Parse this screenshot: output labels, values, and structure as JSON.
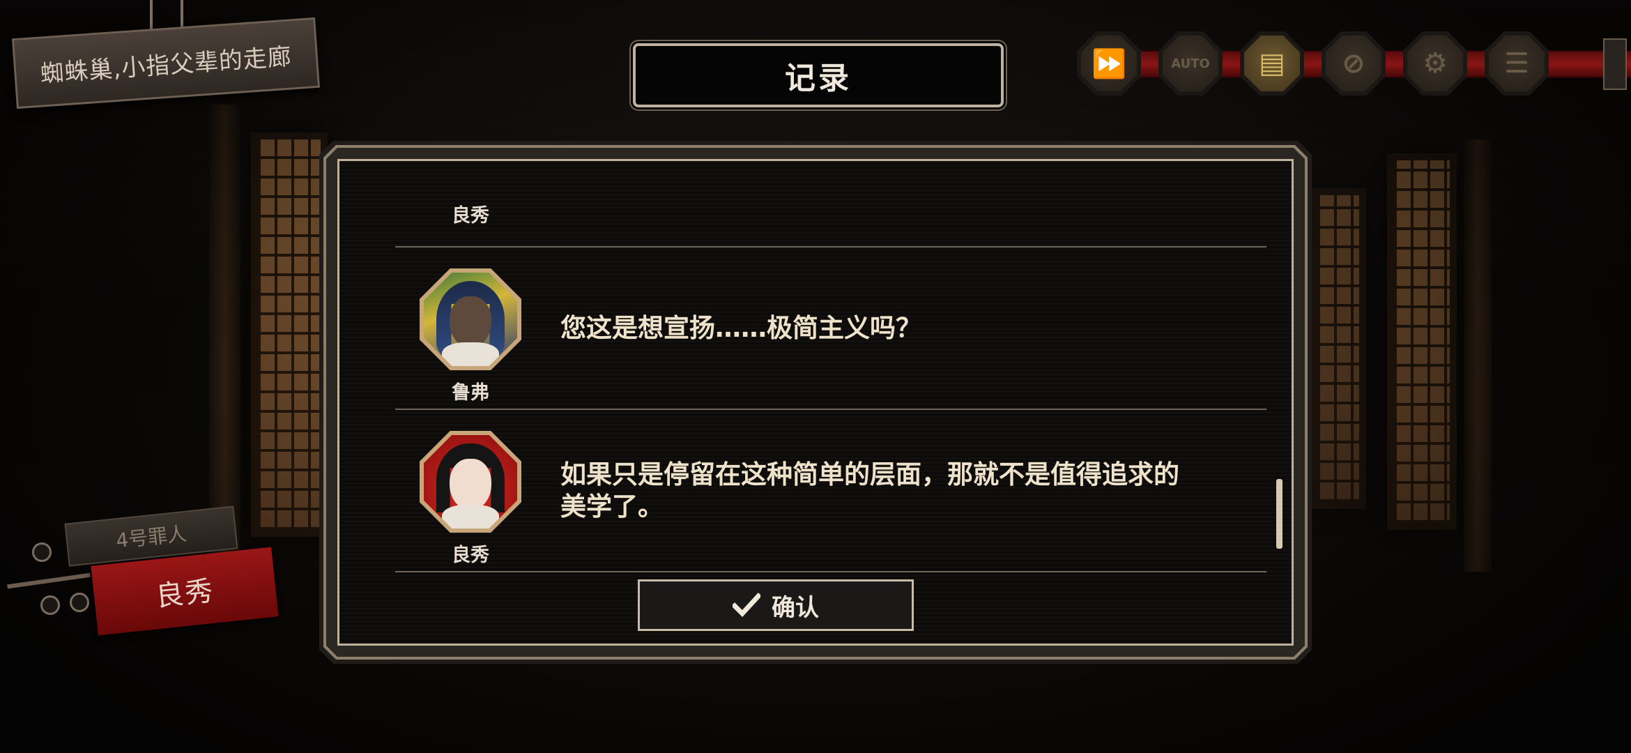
{
  "location": {
    "text": "蜘蛛巢,小指父辈的走廊"
  },
  "toolbar": {
    "buttons": [
      {
        "name": "fast-forward",
        "icon": "fast-forward-icon",
        "glyph": "⏩",
        "active": false
      },
      {
        "name": "auto",
        "icon": "auto-icon",
        "glyph": "AUTO",
        "active": false
      },
      {
        "name": "log",
        "icon": "log-icon",
        "glyph": "▤",
        "active": true
      },
      {
        "name": "hide-ui",
        "icon": "hide-ui-icon",
        "glyph": "⊘",
        "active": false
      },
      {
        "name": "settings",
        "icon": "gear-icon",
        "glyph": "⚙",
        "active": false
      },
      {
        "name": "menu",
        "icon": "menu-icon",
        "glyph": "☰",
        "active": false
      }
    ],
    "rail_color": "#8a1515"
  },
  "log": {
    "title": "记录",
    "entries": [
      {
        "speaker": "良秀",
        "text": "",
        "partial": true
      },
      {
        "speaker": "鲁弗",
        "text": "您这是想宣扬……极简主义吗？",
        "portrait": "rufu"
      },
      {
        "speaker": "良秀",
        "text": "如果只是停留在这种简单的层面，那就不是值得追求的美学了。",
        "portrait": "ryoshu"
      }
    ],
    "confirm_label": "确认"
  },
  "sinner": {
    "number_label": "4号罪人",
    "name": "良秀"
  },
  "colors": {
    "accent_gold": "#bfb29d",
    "sinner_red": "#9a1616",
    "text_cream": "#efe2cb"
  }
}
